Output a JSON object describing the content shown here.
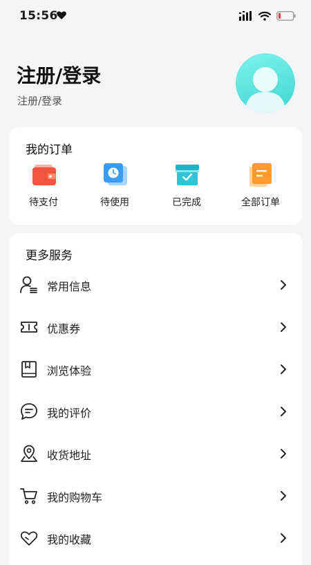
{
  "status_bar": {
    "time": "15:56"
  },
  "profile": {
    "title": "注册/登录",
    "subtitle": "注册/登录"
  },
  "orders": {
    "title": "我的订单",
    "items": [
      {
        "label": "待支付",
        "icon": "wallet-icon"
      },
      {
        "label": "待使用",
        "icon": "clock-icon"
      },
      {
        "label": "已完成",
        "icon": "check-box-icon"
      },
      {
        "label": "全部订单",
        "icon": "list-document-icon"
      }
    ]
  },
  "services": {
    "title": "更多服务",
    "items": [
      {
        "label": "常用信息",
        "icon": "user-info-icon"
      },
      {
        "label": "优惠券",
        "icon": "ticket-icon"
      },
      {
        "label": "浏览体验",
        "icon": "book-icon"
      },
      {
        "label": "我的评价",
        "icon": "chat-bubble-icon"
      },
      {
        "label": "收货地址",
        "icon": "map-pin-icon"
      },
      {
        "label": "我的购物车",
        "icon": "cart-icon"
      },
      {
        "label": "我的收藏",
        "icon": "heart-icon"
      }
    ]
  },
  "colors": {
    "accent_teal": "#3fd5d2",
    "wallet_red": "#f2553f",
    "clock_blue": "#3a9cf3",
    "check_cyan": "#2cc6d6",
    "orders_orange": "#ff9a2e",
    "battery_red": "#e53935"
  }
}
